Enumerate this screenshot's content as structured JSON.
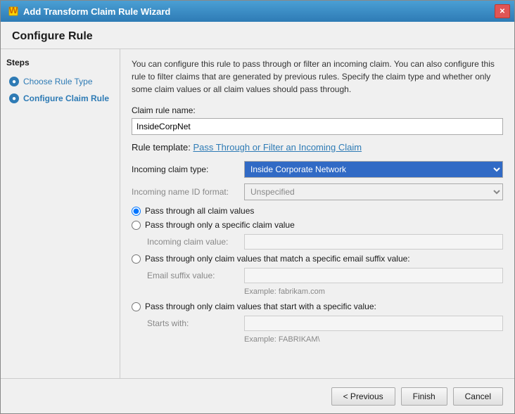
{
  "window": {
    "title": "Add Transform Claim Rule Wizard",
    "close_label": "✕"
  },
  "page": {
    "title": "Configure Rule"
  },
  "sidebar": {
    "steps_label": "Steps",
    "items": [
      {
        "id": "choose-rule-type",
        "label": "Choose Rule Type",
        "active": false
      },
      {
        "id": "configure-claim-rule",
        "label": "Configure Claim Rule",
        "active": true
      }
    ]
  },
  "form": {
    "description": "You can configure this rule to pass through or filter an incoming claim. You can also configure this rule to filter claims that are generated by previous rules. Specify the claim type and whether only some claim values or all claim values should pass through.",
    "claim_rule_name_label": "Claim rule name:",
    "claim_rule_name_value": "InsideCorpNet",
    "rule_template_prefix": "Rule template: ",
    "rule_template_link": "Pass Through or Filter an Incoming Claim",
    "incoming_claim_type_label": "Incoming claim type:",
    "incoming_claim_type_value": "Inside Corporate Network",
    "incoming_name_id_format_label": "Incoming name ID format:",
    "incoming_name_id_format_value": "Unspecified",
    "radio_options": [
      {
        "id": "pass-all",
        "label": "Pass through all claim values",
        "checked": true
      },
      {
        "id": "pass-specific",
        "label": "Pass through only a specific claim value",
        "checked": false
      },
      {
        "id": "pass-email-suffix",
        "label": "Pass through only claim values that match a specific email suffix value:",
        "checked": false
      },
      {
        "id": "pass-starts-with",
        "label": "Pass through only claim values that start with a specific value:",
        "checked": false
      }
    ],
    "incoming_claim_value_label": "Incoming claim value:",
    "email_suffix_label": "Email suffix value:",
    "email_example": "Example: fabrikam.com",
    "starts_with_label": "Starts with:",
    "starts_with_example": "Example: FABRIKAM\\"
  },
  "footer": {
    "previous_label": "< Previous",
    "finish_label": "Finish",
    "cancel_label": "Cancel"
  }
}
